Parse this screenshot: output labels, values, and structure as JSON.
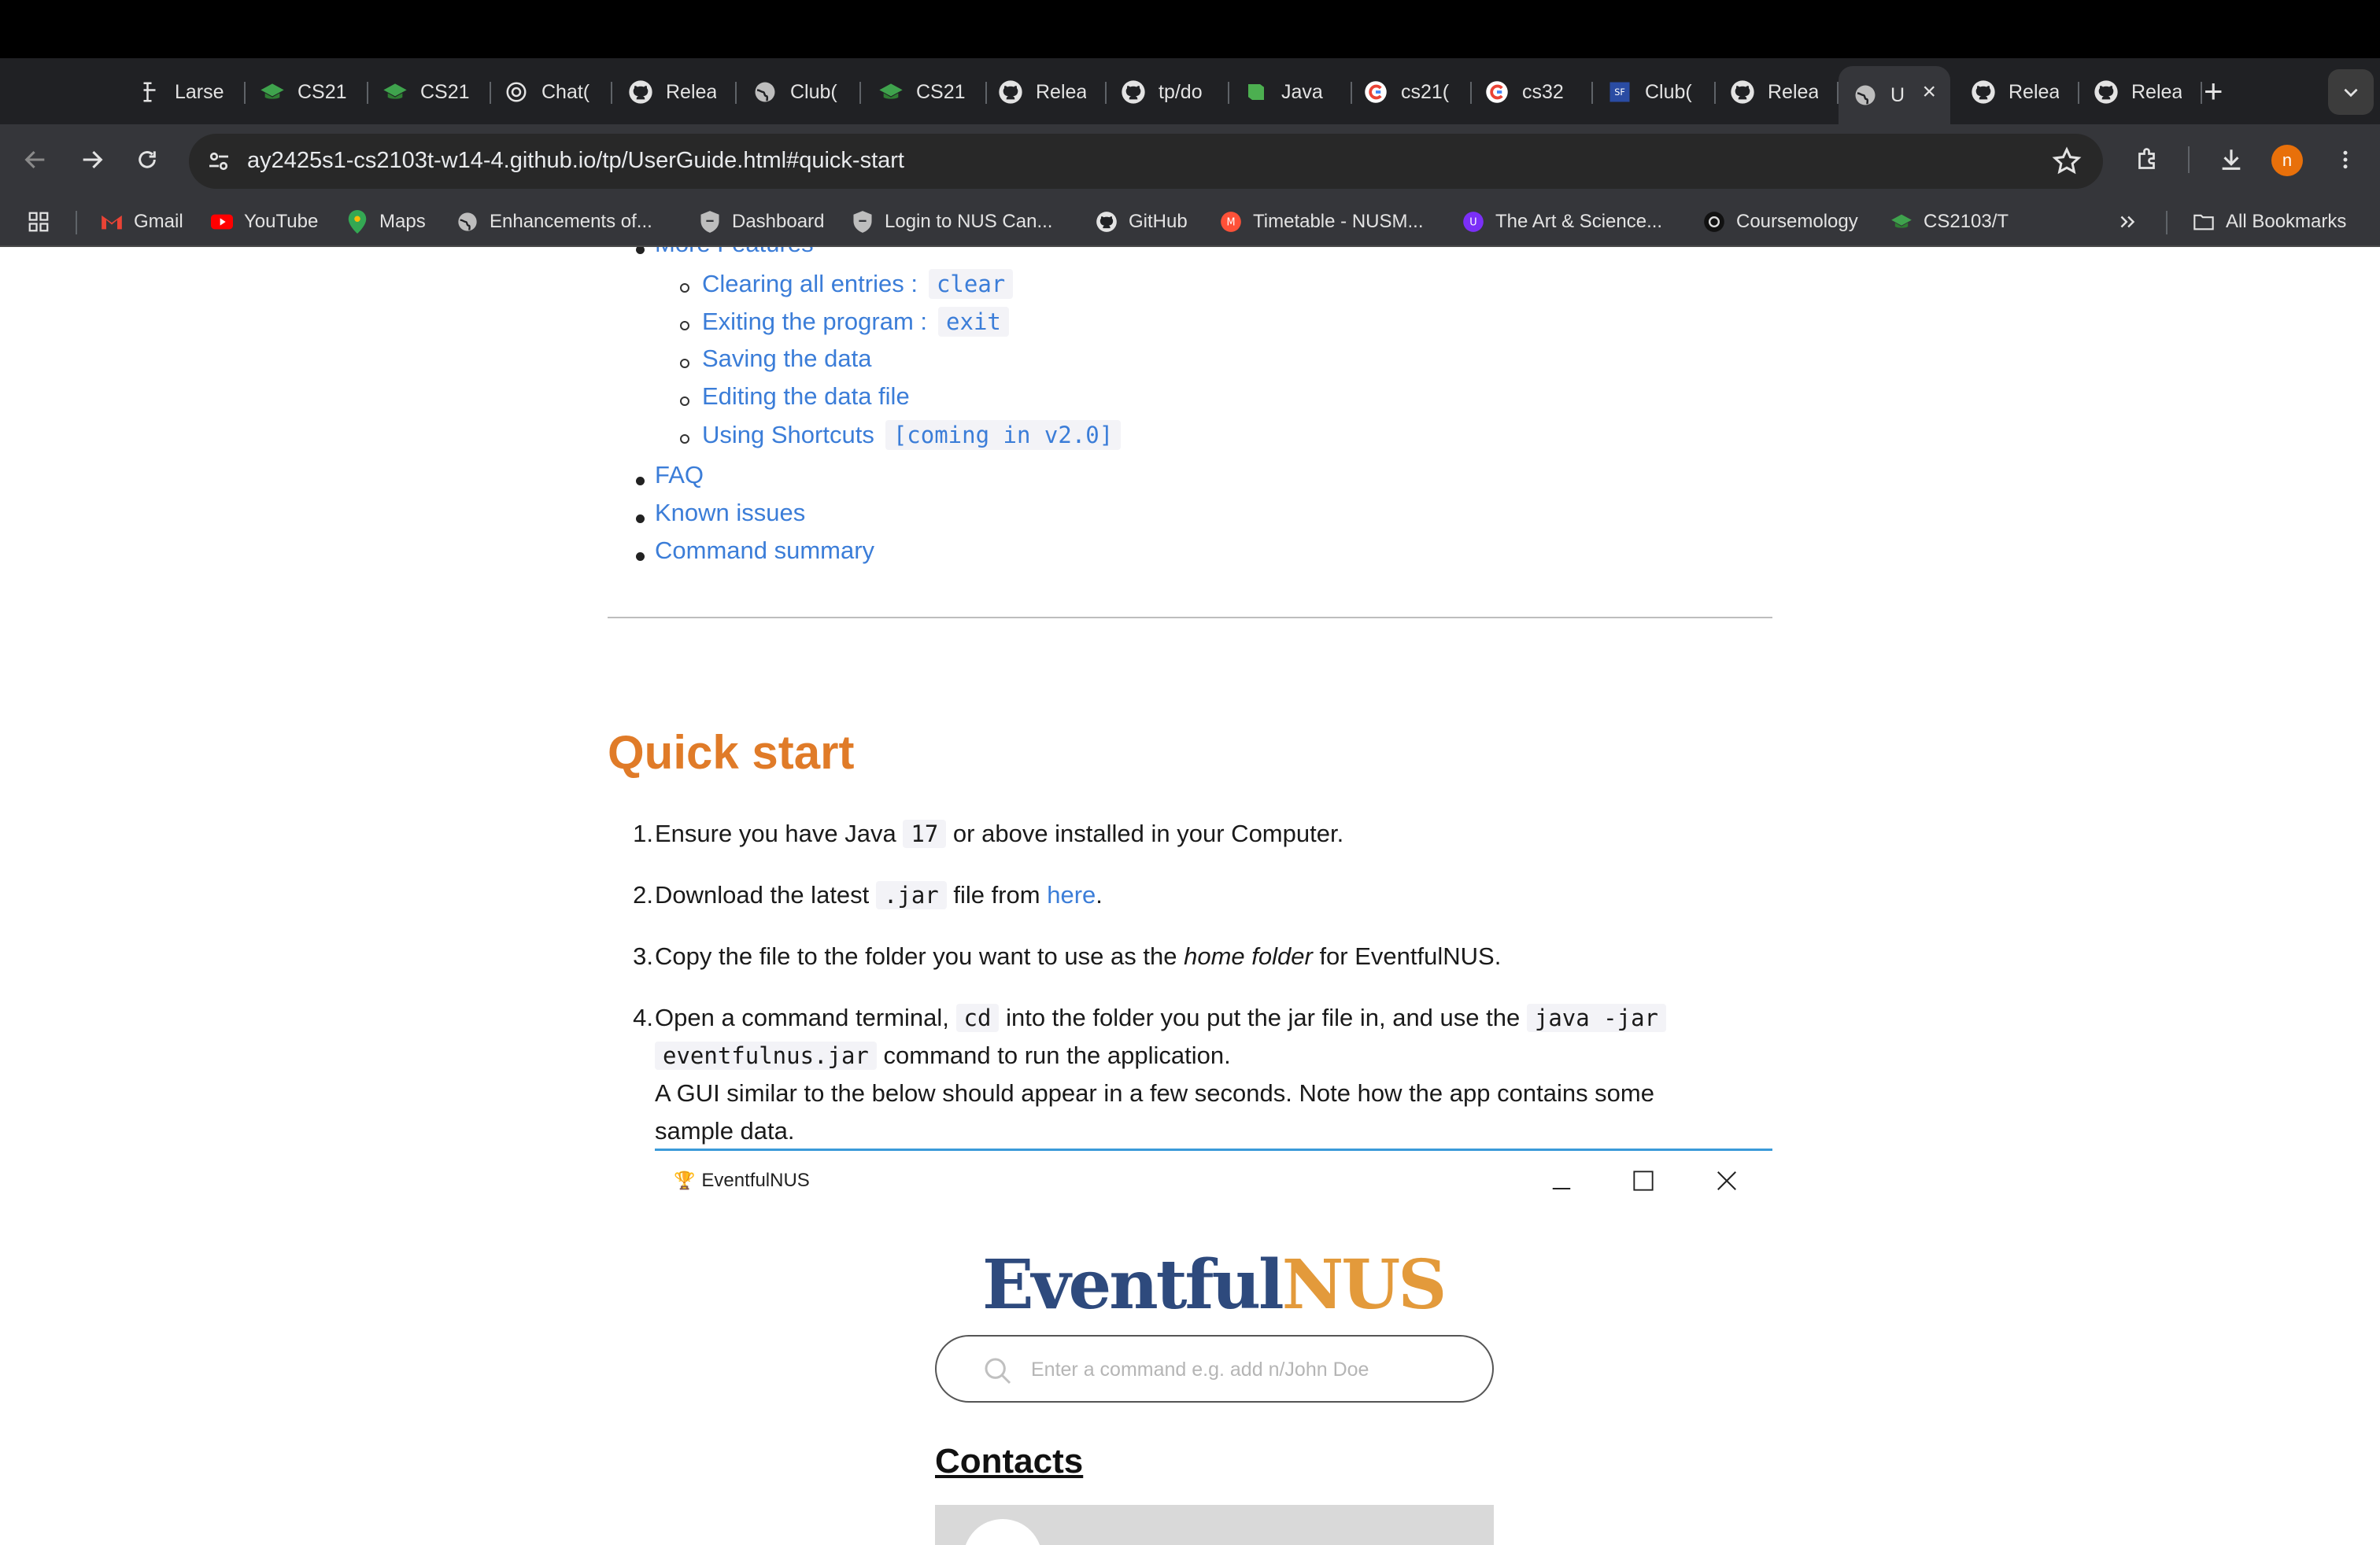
{
  "tabs": [
    {
      "title": "Larse",
      "icon": "larse-icon"
    },
    {
      "title": "CS21(",
      "icon": "graduation-cap-icon"
    },
    {
      "title": "CS21",
      "icon": "graduation-cap-icon"
    },
    {
      "title": "Chat(",
      "icon": "openai-icon"
    },
    {
      "title": "Relea",
      "icon": "github-icon"
    },
    {
      "title": "Club(",
      "icon": "globe-icon"
    },
    {
      "title": "CS21",
      "icon": "graduation-cap-icon"
    },
    {
      "title": "Relea",
      "icon": "github-icon"
    },
    {
      "title": "tp/do",
      "icon": "github-icon"
    },
    {
      "title": "Java",
      "icon": "book-icon"
    },
    {
      "title": "cs21(",
      "icon": "google-icon"
    },
    {
      "title": "cs32",
      "icon": "google-icon"
    },
    {
      "title": "Club(",
      "icon": "sf-icon"
    },
    {
      "title": "Relea",
      "icon": "github-icon"
    },
    {
      "title": "U",
      "icon": "globe-icon",
      "active": true
    },
    {
      "title": "Relea",
      "icon": "github-icon"
    },
    {
      "title": "Relea",
      "icon": "github-icon"
    }
  ],
  "address_bar": {
    "url_host": "ay2425s1-cs2103t-w14-4.github.io",
    "url_path": "/tp/UserGuide.html#quick-start"
  },
  "profile_initial": "n",
  "bookmarks": [
    {
      "label": "Gmail",
      "icon": "gmail-icon"
    },
    {
      "label": "YouTube",
      "icon": "youtube-icon"
    },
    {
      "label": "Maps",
      "icon": "maps-icon"
    },
    {
      "label": "Enhancements of...",
      "icon": "globe-icon"
    },
    {
      "label": "Dashboard",
      "icon": "shield-icon"
    },
    {
      "label": "Login to NUS Can...",
      "icon": "shield-icon"
    },
    {
      "label": "GitHub",
      "icon": "github-icon"
    },
    {
      "label": "Timetable - NUSM...",
      "icon": "nusmods-icon"
    },
    {
      "label": "The Art & Science...",
      "icon": "u-icon"
    },
    {
      "label": "Coursemology",
      "icon": "coursemology-icon"
    },
    {
      "label": "CS2103/T",
      "icon": "graduation-cap-icon"
    }
  ],
  "all_bookmarks_label": "All Bookmarks",
  "toc": {
    "partial_top": "More Features",
    "sub_items": [
      {
        "text": "Clearing all entries :",
        "code": "clear"
      },
      {
        "text": "Exiting the program :",
        "code": "exit"
      },
      {
        "text": "Saving the data",
        "code": ""
      },
      {
        "text": "Editing the data file",
        "code": ""
      },
      {
        "text": "Using Shortcuts",
        "code": "[coming in v2.0]"
      }
    ],
    "items": [
      "FAQ",
      "Known issues",
      "Command summary"
    ]
  },
  "quick_start": {
    "heading": "Quick start",
    "step1": {
      "pre": "Ensure you have Java",
      "code": "17",
      "post": "or above installed in your Computer."
    },
    "step2": {
      "pre": "Download the latest",
      "code": ".jar",
      "mid": "file from",
      "link": "here",
      "post": "."
    },
    "step3": {
      "pre": "Copy the file to the folder you want to use as the",
      "em": "home folder",
      "post": "for EventfulNUS."
    },
    "step4": {
      "pre": "Open a command terminal,",
      "code1": "cd",
      "mid": "into the folder you put the jar file in, and use the",
      "code2": "java -jar",
      "code3": "eventfulnus.jar",
      "post": "command to run the application.",
      "line2": "A GUI similar to the below should appear in a few seconds. Note how the app contains some",
      "line3": "sample data."
    }
  },
  "app_window": {
    "title": "EventfulNUS",
    "logo_a": "Eventful",
    "logo_b": "NUS",
    "search_placeholder": "Enter a command e.g. add n/John Doe",
    "contacts_heading": "Contacts"
  }
}
